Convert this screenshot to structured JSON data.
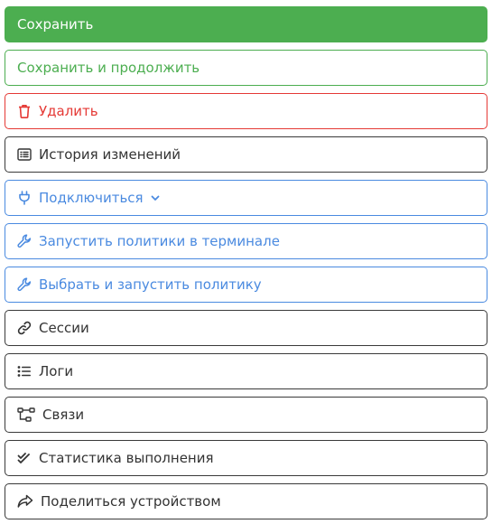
{
  "colors": {
    "success": "#4cae50",
    "danger": "#e53935",
    "info": "#4a8ae0",
    "default_border": "#3a3a3a",
    "default_text": "#333333"
  },
  "actions": {
    "save": {
      "label": "Сохранить"
    },
    "save_continue": {
      "label": "Сохранить и продолжить"
    },
    "delete": {
      "label": "Удалить",
      "icon": "trash-icon"
    },
    "history": {
      "label": "История изменений",
      "icon": "list-alt-icon"
    },
    "connect": {
      "label": "Подключиться",
      "icon": "plug-icon",
      "dropdown_icon": "chevron-down-icon"
    },
    "run_terminal": {
      "label": "Запустить политики в терминале",
      "icon": "wrench-icon"
    },
    "choose_run": {
      "label": "Выбрать и запустить политику",
      "icon": "wrench-icon"
    },
    "sessions": {
      "label": "Сессии",
      "icon": "link-icon"
    },
    "logs": {
      "label": "Логи",
      "icon": "list-icon"
    },
    "relations": {
      "label": "Связи",
      "icon": "sitemap-icon"
    },
    "stats": {
      "label": "Статистика выполнения",
      "icon": "check-double-icon"
    },
    "share": {
      "label": "Поделиться устройством",
      "icon": "share-icon"
    }
  }
}
